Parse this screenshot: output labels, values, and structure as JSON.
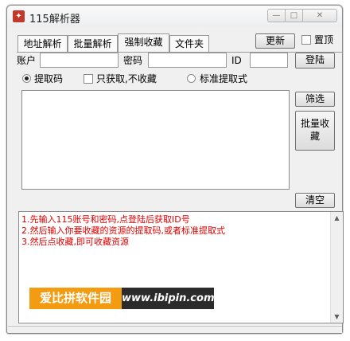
{
  "window": {
    "title": "115解析器",
    "app_icon_glyph": "✦",
    "controls": {
      "minimize": "—",
      "maximize": "□",
      "close": "✕"
    }
  },
  "tabs": [
    {
      "label": "地址解析"
    },
    {
      "label": "批量解析"
    },
    {
      "label": "强制收藏"
    },
    {
      "label": "文件夹"
    }
  ],
  "active_tab": "强制收藏",
  "toolbar": {
    "update_label": "更新",
    "pin_label": "置顶",
    "pin_checked": false
  },
  "login": {
    "account_label": "账户",
    "account_value": "",
    "password_label": "密码",
    "password_value": "",
    "id_label": "ID",
    "id_value": "",
    "login_button": "登陆"
  },
  "options": {
    "extract_code_label": "提取码",
    "extract_code_selected": true,
    "only_get_label": "只获取,不收藏",
    "only_get_checked": false,
    "standard_extract_label": "标准提取式",
    "standard_extract_selected": false
  },
  "buttons": {
    "filter": "筛选",
    "batch_collect": "批量收藏",
    "clear": "清空"
  },
  "instructions": [
    "1.先输入115账号和密码,点登陆后获取ID号",
    "2.然后输入你要收藏的资源的提取码,或者标准提取式",
    "3.然后点收藏,即可收藏资源"
  ],
  "colors": {
    "instruction_text": "#e00000",
    "watermark_orange": "#f39c12",
    "watermark_dark": "#2b2b2b"
  },
  "watermark": {
    "left": "爱比拼软件园",
    "right": "www.ibipin.com"
  }
}
